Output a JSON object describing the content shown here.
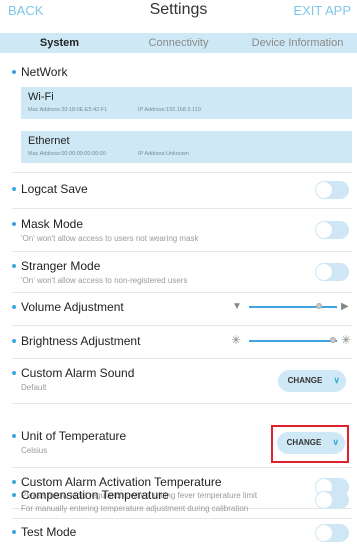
{
  "header": {
    "back": "BACK",
    "title": "Settings",
    "exit": "EXIT APP"
  },
  "tabs": [
    {
      "label": "System",
      "active": true
    },
    {
      "label": "Connectivity",
      "active": false
    },
    {
      "label": "Device Information",
      "active": false
    }
  ],
  "network": {
    "label": "NetWork",
    "wifi": {
      "title": "Wi-Fi",
      "mac": "Mac Address:20:18:0E:E5:42:F1",
      "ip": "IP Address:192.168.3.110"
    },
    "ethernet": {
      "title": "Ethernet",
      "mac": "Mac Address:00:00:00:00:00:00",
      "ip": "IP Address:Unknown"
    }
  },
  "settings": {
    "logcat": {
      "label": "Logcat Save",
      "enabled": false
    },
    "mask": {
      "label": "Mask Mode",
      "sub": "'On' won't allow access to users not wearing mask",
      "enabled": false
    },
    "stranger": {
      "label": "Stranger Mode",
      "sub": "'On' won't allow access to non-registered users",
      "enabled": false
    },
    "volume": {
      "label": "Volume Adjustment",
      "level": 0.8
    },
    "brightness": {
      "label": "Brightness Adjustment",
      "level": 0.95
    },
    "alarm_sound": {
      "label": "Custom Alarm Sound",
      "sub": "Default",
      "button": "CHANGE"
    },
    "temp_unit": {
      "label": "Unit of Temperature",
      "sub": "Celsius",
      "button": "CHANGE"
    },
    "alarm_temp": {
      "label": "Custom Alarm Activation Temperature",
      "sub": "Please follow local regulations when setting fever temperature limit",
      "enabled": false
    },
    "compensation": {
      "label": "Compensation Temperature",
      "sub": "For manually entering temperature adjustment during calibration",
      "enabled": false
    },
    "test_mode": {
      "label": "Test Mode",
      "enabled": false
    }
  },
  "icons": {
    "volume_low": "speaker-low-icon",
    "volume_high": "speaker-high-icon",
    "brightness_low": "brightness-low-icon",
    "brightness_high": "brightness-high-icon",
    "chevron": "chevron-down-icon"
  },
  "colors": {
    "accent": "#3aa6dd",
    "tab_bg": "#cfe8f6",
    "highlight": "#e0202a"
  }
}
